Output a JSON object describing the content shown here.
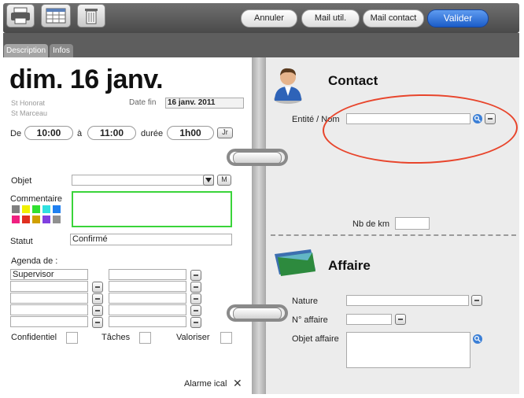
{
  "toolbar": {
    "icons": [
      "printer-icon",
      "calendar-icon",
      "trash-icon"
    ],
    "cancel_label": "Annuler",
    "mail_user_label": "Mail util.",
    "mail_contact_label": "Mail contact",
    "validate_label": "Valider"
  },
  "tabs": [
    {
      "label": "Description"
    },
    {
      "label": "Infos"
    }
  ],
  "event": {
    "date_title": "dim. 16 janv.",
    "saint1": "St Honorat",
    "saint2": "St Marceau",
    "end_date_label": "Date  fin",
    "end_date_value": "16 janv. 2011",
    "from_label": "De",
    "from_value": "10:00",
    "to_label": "à",
    "to_value": "11:00",
    "duration_label": "durée",
    "duration_value": "1h00",
    "day_button": "Jr"
  },
  "form": {
    "object_label": "Objet",
    "object_value": "",
    "m_button": "M",
    "comment_label": "Commentaire",
    "comment_value": "",
    "swatches": [
      "#808080",
      "#f0f000",
      "#30e030",
      "#30e0e0",
      "#2080f0",
      "#f02080",
      "#e03020",
      "#d0a000",
      "#8040e0",
      "#909090"
    ],
    "status_label": "Statut",
    "status_value": "Confirmé",
    "agenda_label": "Agenda de :",
    "agenda_first": "Supervisor",
    "confidential_label": "Confidentiel",
    "tasks_label": "Tâches",
    "valoriser_label": "Valoriser",
    "alarm_label": "Alarme ical",
    "alarm_mark": "✕"
  },
  "contact": {
    "title": "Contact",
    "entity_label": "Entité / Nom",
    "entity_value": "",
    "km_label": "Nb de km",
    "km_value": ""
  },
  "affaire": {
    "title": "Affaire",
    "nature_label": "Nature",
    "nature_value": "",
    "number_label": "N° affaire",
    "number_value": "",
    "object_label": "Objet affaire",
    "object_value": ""
  },
  "colors": {
    "accent": "#1b5cc8",
    "highlight_border": "#3ad43a",
    "annotation": "#e8452c"
  }
}
